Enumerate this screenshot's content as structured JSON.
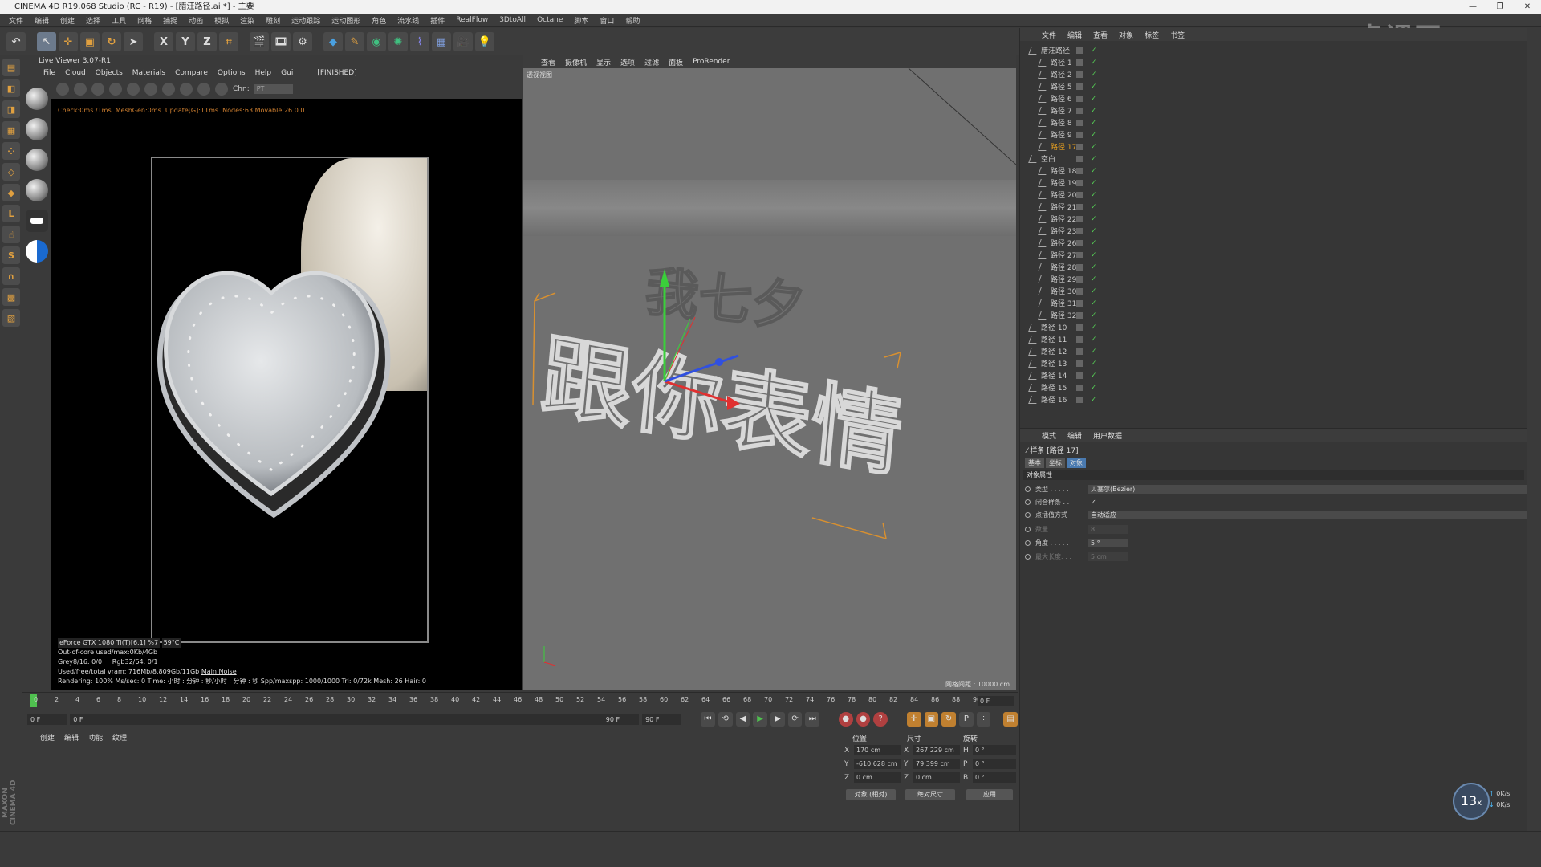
{
  "title": "CINEMA 4D R19.068 Studio (RC - R19) - [腊汪路径.ai *] - 主要",
  "window_controls": [
    "—",
    "❐",
    "✕"
  ],
  "menubar": [
    "文件",
    "编辑",
    "创建",
    "选择",
    "工具",
    "网格",
    "捕捉",
    "动画",
    "模拟",
    "渲染",
    "雕刻",
    "运动跟踪",
    "运动图形",
    "角色",
    "流水线",
    "插件",
    "RealFlow",
    "3DtoAll",
    "Octane",
    "脚本",
    "窗口",
    "帮助"
  ],
  "toolbar": {
    "x": "X",
    "y": "Y",
    "z": "Z"
  },
  "live_viewer": {
    "title": "Live Viewer 3.07-R1",
    "menu": [
      "File",
      "Cloud",
      "Objects",
      "Materials",
      "Compare",
      "Options",
      "Help",
      "Gui",
      "[FINISHED]"
    ],
    "chn_label": "Chn:",
    "chn_value": "PT",
    "status": "Check:0ms./1ms. MeshGen:0ms. Update[G]:11ms. Nodes:63 Movable:26  0 0",
    "info_gpu": "eForce GTX 1080 Ti(T)[6.1] %7",
    "info_temp": "59°C",
    "info_line2": "Out-of-core used/max:0Kb/4Gb",
    "info_line3a": "Grey8/16: 0/0",
    "info_line3b": "Rgb32/64: 0/1",
    "info_line4": "Used/free/total vram: 716Mb/8.809Gb/11Gb",
    "info_tabs": "Main  Noise",
    "info_line5": "Rendering: 100%   Ms/sec: 0   Time: 小时 : 分钟 : 秒/小时 : 分钟 : 秒   Spp/maxspp: 1000/1000   Tri: 0/72k   Mesh: 26   Hair: 0"
  },
  "viewport": {
    "menu": [
      "查看",
      "摄像机",
      "显示",
      "选项",
      "过滤",
      "面板",
      "ProRender"
    ],
    "label": "透视视图",
    "text_top": "我七夕",
    "text_main": "跟你表情",
    "grid_label": "网格间距 : 10000 cm"
  },
  "timeline": {
    "ticks": [
      "0",
      "2",
      "4",
      "6",
      "8",
      "10",
      "12",
      "14",
      "16",
      "18",
      "20",
      "22",
      "24",
      "26",
      "28",
      "30",
      "32",
      "34",
      "36",
      "38",
      "40",
      "42",
      "44",
      "46",
      "48",
      "50",
      "52",
      "54",
      "56",
      "58",
      "60",
      "62",
      "64",
      "66",
      "68",
      "70",
      "72",
      "74",
      "76",
      "78",
      "80",
      "82",
      "84",
      "86",
      "88",
      "90"
    ],
    "current_frame": "0 F",
    "start": "0 F",
    "start2": "0 F",
    "end": "90 F",
    "end2": "90 F"
  },
  "material_menu": [
    "创建",
    "编辑",
    "功能",
    "纹理"
  ],
  "coords": {
    "header_pos": "位置",
    "header_size": "尺寸",
    "header_rot": "旋转",
    "rows": [
      {
        "axis": "X",
        "pos": "170 cm",
        "size_axis": "X",
        "size": "267.229 cm",
        "rot_axis": "H",
        "rot": "0 °"
      },
      {
        "axis": "Y",
        "pos": "-610.628 cm",
        "size_axis": "Y",
        "size": "79.399 cm",
        "rot_axis": "P",
        "rot": "0 °"
      },
      {
        "axis": "Z",
        "pos": "0 cm",
        "size_axis": "Z",
        "size": "0 cm",
        "rot_axis": "B",
        "rot": "0 °"
      }
    ],
    "btn_object": "对象 (相对)",
    "btn_size": "绝对尺寸",
    "btn_apply": "应用"
  },
  "object_manager": {
    "menu": [
      "文件",
      "编辑",
      "查看",
      "对象",
      "标签",
      "书签"
    ],
    "items": [
      {
        "label": "腊汪路径",
        "level": 0,
        "selected": false
      },
      {
        "label": "路径 1",
        "level": 1,
        "selected": false
      },
      {
        "label": "路径 2",
        "level": 1,
        "selected": false
      },
      {
        "label": "路径 5",
        "level": 1,
        "selected": false
      },
      {
        "label": "路径 6",
        "level": 1,
        "selected": false
      },
      {
        "label": "路径 7",
        "level": 1,
        "selected": false
      },
      {
        "label": "路径 8",
        "level": 1,
        "selected": false
      },
      {
        "label": "路径 9",
        "level": 1,
        "selected": false
      },
      {
        "label": "路径 17",
        "level": 1,
        "selected": true
      },
      {
        "label": "空白",
        "level": 0,
        "selected": false
      },
      {
        "label": "路径 18",
        "level": 1,
        "selected": false
      },
      {
        "label": "路径 19",
        "level": 1,
        "selected": false
      },
      {
        "label": "路径 20",
        "level": 1,
        "selected": false
      },
      {
        "label": "路径 21",
        "level": 1,
        "selected": false
      },
      {
        "label": "路径 22",
        "level": 1,
        "selected": false
      },
      {
        "label": "路径 23",
        "level": 1,
        "selected": false
      },
      {
        "label": "路径 26",
        "level": 1,
        "selected": false
      },
      {
        "label": "路径 27",
        "level": 1,
        "selected": false
      },
      {
        "label": "路径 28",
        "level": 1,
        "selected": false
      },
      {
        "label": "路径 29",
        "level": 1,
        "selected": false
      },
      {
        "label": "路径 30",
        "level": 1,
        "selected": false
      },
      {
        "label": "路径 31",
        "level": 1,
        "selected": false
      },
      {
        "label": "路径 32",
        "level": 1,
        "selected": false
      },
      {
        "label": "路径 10",
        "level": 0,
        "selected": false
      },
      {
        "label": "路径 11",
        "level": 0,
        "selected": false
      },
      {
        "label": "路径 12",
        "level": 0,
        "selected": false
      },
      {
        "label": "路径 13",
        "level": 0,
        "selected": false
      },
      {
        "label": "路径 14",
        "level": 0,
        "selected": false
      },
      {
        "label": "路径 15",
        "level": 0,
        "selected": false
      },
      {
        "label": "路径 16",
        "level": 0,
        "selected": false
      }
    ]
  },
  "attribute_manager": {
    "menu": [
      "模式",
      "编辑",
      "用户数据"
    ],
    "object_label": "样条 [路径 17]",
    "tabs": [
      "基本",
      "坐标",
      "对象"
    ],
    "section": "对象属性",
    "rows": [
      {
        "label": "类型 . . . . .",
        "value": "贝塞尔(Bezier)",
        "dim": false
      },
      {
        "label": "闭合样条 . .",
        "value": "✓",
        "dim": false
      },
      {
        "label": "点插值方式",
        "value": "自动适应",
        "dim": false
      },
      {
        "label": "数量 . . . . .",
        "value": "8",
        "dim": true
      },
      {
        "label": "角度 . . . . .",
        "value": "5 °",
        "dim": false
      },
      {
        "label": "最大长度. . .",
        "value": "5 cm",
        "dim": true
      }
    ]
  },
  "perf": {
    "percent": "13",
    "unit": "x",
    "up": "0K/s",
    "down": "0K/s"
  },
  "watermark": "虎课网",
  "colors": {
    "accent": "#e8a020",
    "select": "#4a7ab0",
    "check": "#55cc55"
  }
}
